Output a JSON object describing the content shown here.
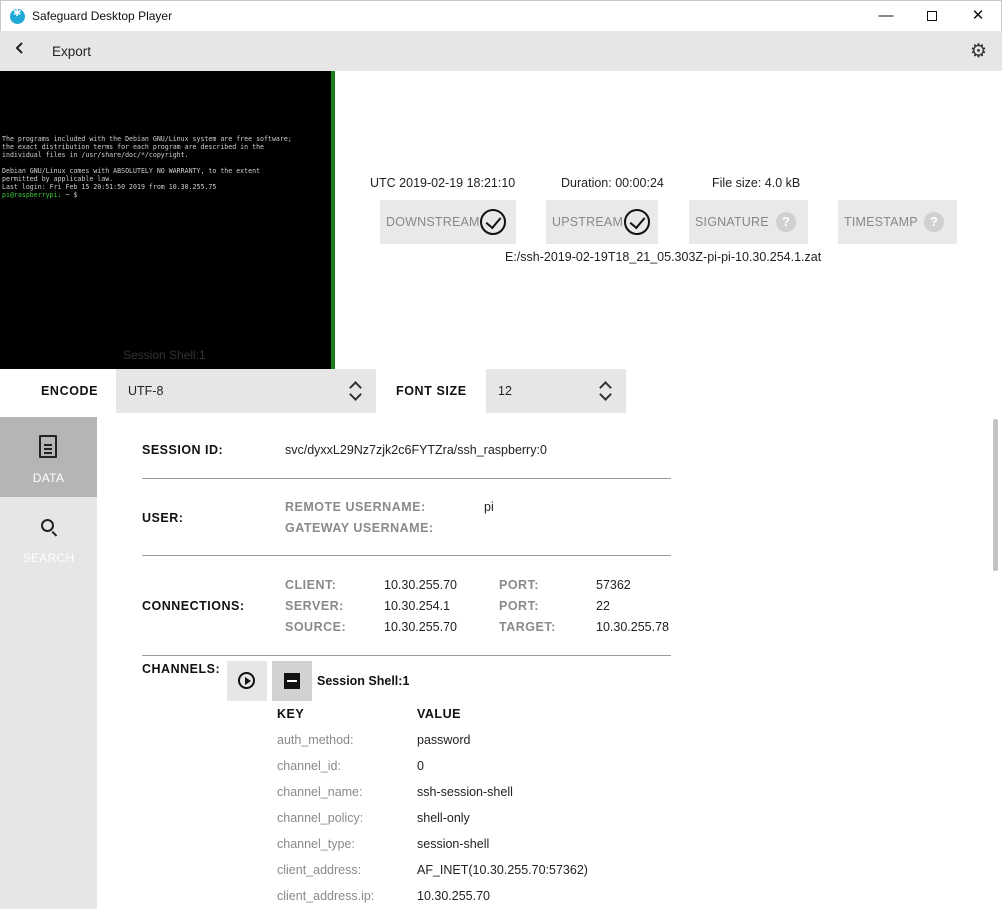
{
  "window": {
    "title": "Safeguard Desktop Player",
    "minimize": "—",
    "close": "✕"
  },
  "header": {
    "back_icon": "‹",
    "title": "Export",
    "settings_icon": "⚙"
  },
  "terminal": {
    "lines": [
      "The programs included with the Debian GNU/Linux system are free software;",
      "the exact distribution terms for each program are described in the",
      "individual files in /usr/share/doc/*/copyright.",
      "",
      "Debian GNU/Linux comes with ABSOLUTELY NO WARRANTY, to the extent",
      "permitted by applicable law.",
      "Last login: Fri Feb 15 20:51:50 2019 from 10.30.255.75"
    ],
    "prompt": "pi@raspberrypi:",
    "prompt_suffix": " ~ $ ",
    "caption": "Session Shell:1"
  },
  "recording": {
    "date": "UTC 2019-02-19 18:21:10",
    "duration": "Duration:  00:00:24",
    "file_size": "File size:  4.0 kB",
    "file_path": "E:/ssh-2019-02-19T18_21_05.303Z-pi-pi-10.30.254.1.zat"
  },
  "verification": {
    "downstream": "DOWNSTREAM",
    "upstream": "UPSTREAM",
    "signature": "SIGNATURE",
    "timestamp": "TIMESTAMP",
    "unknown_mark": "?"
  },
  "settings": {
    "encode_label": "ENCODE",
    "encode_value": "UTF-8",
    "font_size_label": "FONT SIZE",
    "font_size_value": "12"
  },
  "nav": {
    "data": "DATA",
    "search": "SEARCH"
  },
  "details": {
    "session_id_label": "SESSION ID:",
    "session_id": "svc/dyxxL29Nz7zjk2c6FYTZra/ssh_raspberry:0",
    "user_label": "USER:",
    "remote_username_label": "REMOTE USERNAME:",
    "remote_username": "pi",
    "gateway_username_label": "GATEWAY USERNAME:",
    "connections_label": "CONNECTIONS:",
    "client_label": "CLIENT:",
    "client": "10.30.255.70",
    "client_port_label": "PORT:",
    "client_port": "57362",
    "server_label": "SERVER:",
    "server": "10.30.254.1",
    "server_port_label": "PORT:",
    "server_port": "22",
    "source_label": "SOURCE:",
    "source": "10.30.255.70",
    "target_label": "TARGET:",
    "target": "10.30.255.78",
    "channels_label": "CHANNELS:",
    "channel_name": "Session Shell:1",
    "key_header": "KEY",
    "value_header": "VALUE",
    "rows": [
      {
        "key": "auth_method:",
        "value": "password"
      },
      {
        "key": "channel_id:",
        "value": "0"
      },
      {
        "key": "channel_name:",
        "value": "ssh-session-shell"
      },
      {
        "key": "channel_policy:",
        "value": "shell-only"
      },
      {
        "key": "channel_type:",
        "value": "session-shell"
      },
      {
        "key": "client_address:",
        "value": "AF_INET(10.30.255.70:57362)"
      },
      {
        "key": "client_address.ip:",
        "value": "10.30.255.70"
      }
    ]
  }
}
